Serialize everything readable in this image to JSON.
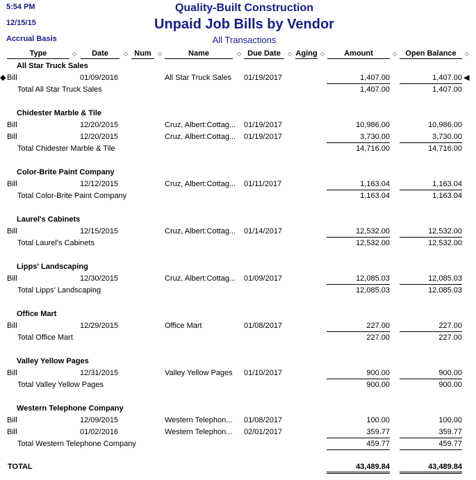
{
  "header": {
    "time": "5:54 PM",
    "date": "12/15/15",
    "basis": "Accrual Basis",
    "company": "Quality-Built Construction",
    "report_title": "Unpaid Job Bills by Vendor",
    "subtitle": "All Transactions"
  },
  "columns": [
    "Type",
    "Date",
    "Num",
    "Name",
    "Due Date",
    "Aging",
    "Amount",
    "Open Balance"
  ],
  "icons": {
    "sort": "◇",
    "row_marker_left": "◆",
    "row_marker_right": "◀"
  },
  "vendors": [
    {
      "name": "All Star Truck Sales",
      "rows": [
        {
          "type": "Bill",
          "date": "01/09/2016",
          "num": "",
          "name": "All Star Truck Sales",
          "due": "01/19/2017",
          "aging": "",
          "amount": "1,407.00",
          "balance": "1,407.00"
        }
      ],
      "total_label": "Total All Star Truck Sales",
      "total_amount": "1,407.00",
      "total_balance": "1,407.00"
    },
    {
      "name": "Chidester Marble & Tile",
      "rows": [
        {
          "type": "Bill",
          "date": "12/20/2015",
          "num": "",
          "name": "Cruz, Albert:Cottag...",
          "due": "01/19/2017",
          "aging": "",
          "amount": "10,986.00",
          "balance": "10,986.00"
        },
        {
          "type": "Bill",
          "date": "12/20/2015",
          "num": "",
          "name": "Cruz, Albert:Cottag...",
          "due": "01/19/2017",
          "aging": "",
          "amount": "3,730.00",
          "balance": "3,730.00"
        }
      ],
      "total_label": "Total Chidester Marble & Tile",
      "total_amount": "14,716.00",
      "total_balance": "14,716.00"
    },
    {
      "name": "Color-Brite Paint Company",
      "rows": [
        {
          "type": "Bill",
          "date": "12/12/2015",
          "num": "",
          "name": "Cruz, Albert:Cottag...",
          "due": "01/11/2017",
          "aging": "",
          "amount": "1,163.04",
          "balance": "1,163.04"
        }
      ],
      "total_label": "Total Color-Brite Paint Company",
      "total_amount": "1,163.04",
      "total_balance": "1,163.04"
    },
    {
      "name": "Laurel's Cabinets",
      "rows": [
        {
          "type": "Bill",
          "date": "12/15/2015",
          "num": "",
          "name": "Cruz, Albert:Cottag...",
          "due": "01/14/2017",
          "aging": "",
          "amount": "12,532.00",
          "balance": "12,532.00"
        }
      ],
      "total_label": "Total Laurel's Cabinets",
      "total_amount": "12,532.00",
      "total_balance": "12,532.00"
    },
    {
      "name": "Lipps' Landscaping",
      "rows": [
        {
          "type": "Bill",
          "date": "12/30/2015",
          "num": "",
          "name": "Cruz, Albert:Cottag...",
          "due": "01/09/2017",
          "aging": "",
          "amount": "12,085.03",
          "balance": "12,085.03"
        }
      ],
      "total_label": "Total Lipps' Landscaping",
      "total_amount": "12,085.03",
      "total_balance": "12,085.03"
    },
    {
      "name": "Office Mart",
      "rows": [
        {
          "type": "Bill",
          "date": "12/29/2015",
          "num": "",
          "name": "Office Mart",
          "due": "01/08/2017",
          "aging": "",
          "amount": "227.00",
          "balance": "227.00"
        }
      ],
      "total_label": "Total Office Mart",
      "total_amount": "227.00",
      "total_balance": "227.00"
    },
    {
      "name": "Valley Yellow Pages",
      "rows": [
        {
          "type": "Bill",
          "date": "12/31/2015",
          "num": "",
          "name": "Valley Yellow Pages",
          "due": "01/10/2017",
          "aging": "",
          "amount": "900.00",
          "balance": "900.00"
        }
      ],
      "total_label": "Total Valley Yellow Pages",
      "total_amount": "900.00",
      "total_balance": "900.00"
    },
    {
      "name": "Western Telephone Company",
      "rows": [
        {
          "type": "Bill",
          "date": "12/09/2015",
          "num": "",
          "name": "Western Telephon...",
          "due": "01/08/2017",
          "aging": "",
          "amount": "100.00",
          "balance": "100.00"
        },
        {
          "type": "Bill",
          "date": "01/02/2016",
          "num": "",
          "name": "Western Telephon...",
          "due": "02/01/2017",
          "aging": "",
          "amount": "359.77",
          "balance": "359.77"
        }
      ],
      "total_label": "Total Western Telephone Company",
      "total_amount": "459.77",
      "total_balance": "459.77"
    }
  ],
  "grand_total": {
    "label": "TOTAL",
    "amount": "43,489.84",
    "balance": "43,489.84"
  }
}
